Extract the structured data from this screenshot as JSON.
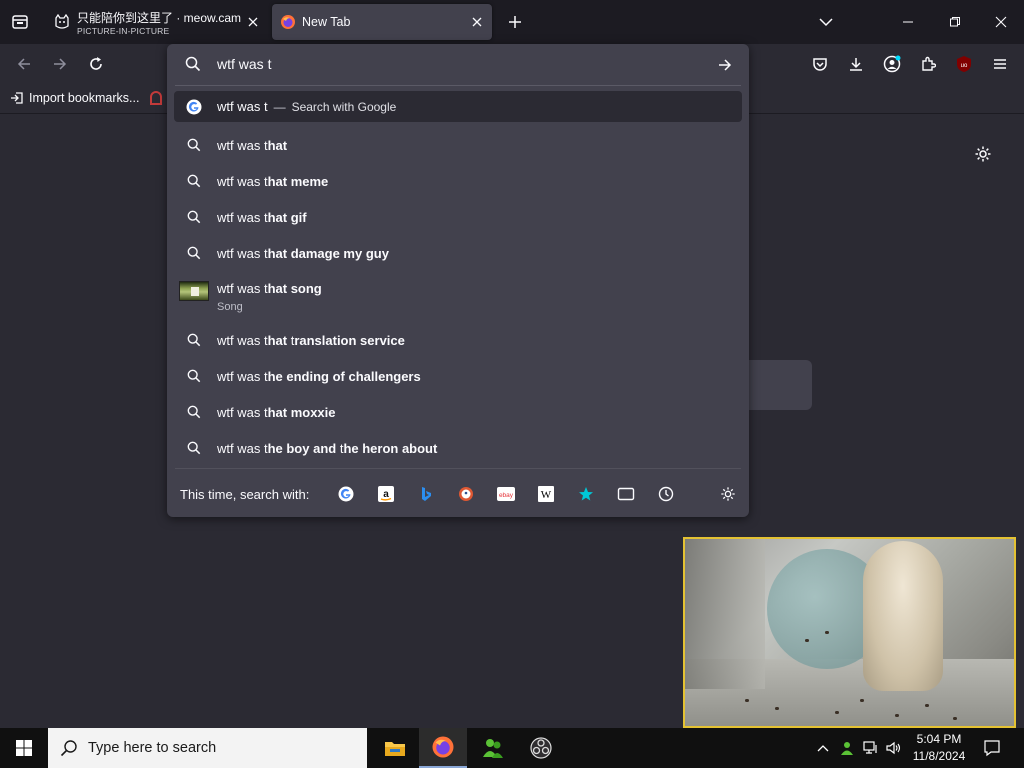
{
  "tabs": [
    {
      "title": "只能陪你到这里了 · meow.cam",
      "subtitle": "PICTURE-IN-PICTURE",
      "icon": "cat-icon"
    },
    {
      "title": "New Tab",
      "icon": "firefox-icon"
    }
  ],
  "bookmarks_toolbar": {
    "import_label": "Import bookmarks..."
  },
  "urlbar": {
    "value": "wtf was t",
    "first_result": {
      "query": "wtf was t",
      "separator": "—",
      "action": "Search with Google"
    },
    "suggestions": [
      {
        "prefix": "wtf was t",
        "bold": "hat",
        "rest": ""
      },
      {
        "prefix": "wtf was t",
        "bold": "hat meme",
        "rest": ""
      },
      {
        "prefix": "wtf was t",
        "bold": "hat gif",
        "rest": ""
      },
      {
        "prefix": "wtf was t",
        "bold": "hat damage my guy",
        "rest": ""
      },
      {
        "prefix": "wtf was t",
        "bold": "hat song",
        "rest": "",
        "subtitle": "Song",
        "thumbnail": true
      },
      {
        "prefix": "wtf was t",
        "bold": "hat",
        "mid": " t",
        "bold2": "ranslation service"
      },
      {
        "prefix": "wtf was t",
        "bold": "he ending of challengers",
        "rest": ""
      },
      {
        "prefix": "wtf was t",
        "bold": "hat moxxie",
        "rest": ""
      },
      {
        "prefix": "wtf was t",
        "bold": "he boy and ",
        "mid": "t",
        "bold2": "he heron about"
      }
    ],
    "one_off_label": "This time, search with:",
    "engines": [
      "google-icon",
      "amazon-icon",
      "bing-icon",
      "duckduckgo-icon",
      "ebay-icon",
      "wikipedia-icon",
      "bookmarks-star-icon",
      "tabs-icon",
      "history-icon",
      "search-settings-icon"
    ]
  },
  "taskbar": {
    "search_placeholder": "Type here to search",
    "time": "5:04 PM",
    "date": "11/8/2024"
  },
  "colors": {
    "toolbar_bg": "#2b2a33",
    "tabstrip_bg": "#1c1b22",
    "popup_bg": "#42414d",
    "pip_border": "#e4c233"
  }
}
